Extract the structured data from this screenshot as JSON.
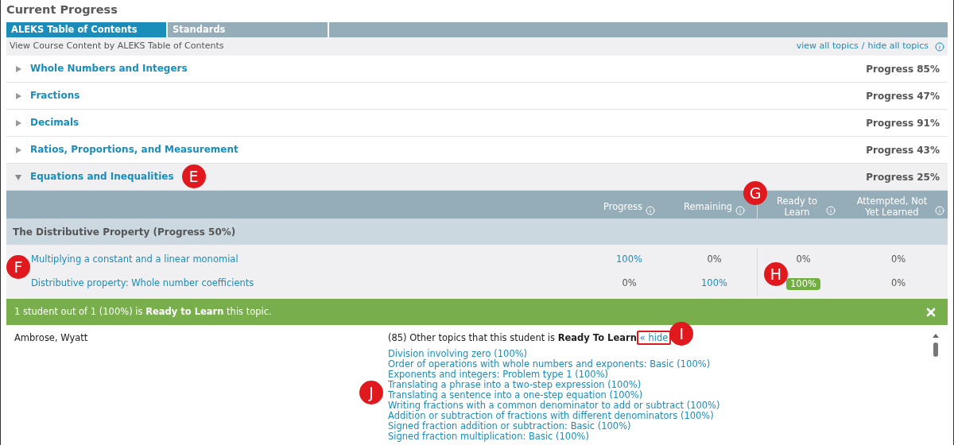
{
  "title": "Current Progress",
  "tabs": [
    {
      "label": "ALEKS Table of Contents",
      "selected": true
    },
    {
      "label": "Standards",
      "selected": false
    }
  ],
  "subheader": {
    "text": "View Course Content by ALEKS Table of Contents",
    "view_all": "view all topics",
    "separator": "/",
    "hide_all": "hide all topics"
  },
  "categories": [
    {
      "name": "Whole Numbers and Integers",
      "progress": "Progress 85%",
      "expanded": false
    },
    {
      "name": "Fractions",
      "progress": "Progress 47%",
      "expanded": false
    },
    {
      "name": "Decimals",
      "progress": "Progress 91%",
      "expanded": false
    },
    {
      "name": "Ratios, Proportions, and Measurement",
      "progress": "Progress 43%",
      "expanded": false
    },
    {
      "name": "Equations and Inequalities",
      "progress": "Progress 25%",
      "expanded": true,
      "callout": "E"
    }
  ],
  "table": {
    "columns": [
      {
        "label": "Progress"
      },
      {
        "label": "Remaining"
      },
      {
        "label": "Ready to Learn",
        "callout": "G"
      },
      {
        "label": "Attempted, Not Yet Learned"
      }
    ],
    "group": "The Distributive Property (Progress 50%)",
    "rows_callout": "F",
    "rows": [
      {
        "name": "Multiplying a constant and a linear monomial",
        "cells": [
          {
            "value": "100%",
            "kind": "link"
          },
          {
            "value": "0%",
            "kind": "plain"
          },
          {
            "value": "0%",
            "kind": "plain"
          },
          {
            "value": "0%",
            "kind": "plain"
          }
        ]
      },
      {
        "name": "Distributive property: Whole number coefficients",
        "cells": [
          {
            "value": "0%",
            "kind": "plain"
          },
          {
            "value": "100%",
            "kind": "link"
          },
          {
            "value": "100%",
            "kind": "badge",
            "callout": "H"
          },
          {
            "value": "0%",
            "kind": "plain"
          }
        ]
      }
    ]
  },
  "banner": {
    "text": "1 student out of 1 (100%) is **Ready to Learn** this topic."
  },
  "student": {
    "name": "Ambrose, Wyatt",
    "summary": "(85) Other topics that this student is **Ready To Learn**",
    "hide_link": "« hide",
    "hide_highlighted": true,
    "hide_callout": "I",
    "topics_callout": "J",
    "topics": [
      "Division involving zero (100%)",
      "Order of operations with whole numbers and exponents: Basic (100%)",
      "Exponents and integers: Problem type 1 (100%)",
      "Translating a phrase into a two-step expression (100%)",
      "Translating a sentence into a one-step equation (100%)",
      "Writing fractions with a common denominator to add or subtract (100%)",
      "Addition or subtraction of fractions with different denominators (100%)",
      "Signed fraction addition or subtraction: Basic (100%)",
      "Signed fraction multiplication: Basic (100%)"
    ]
  }
}
